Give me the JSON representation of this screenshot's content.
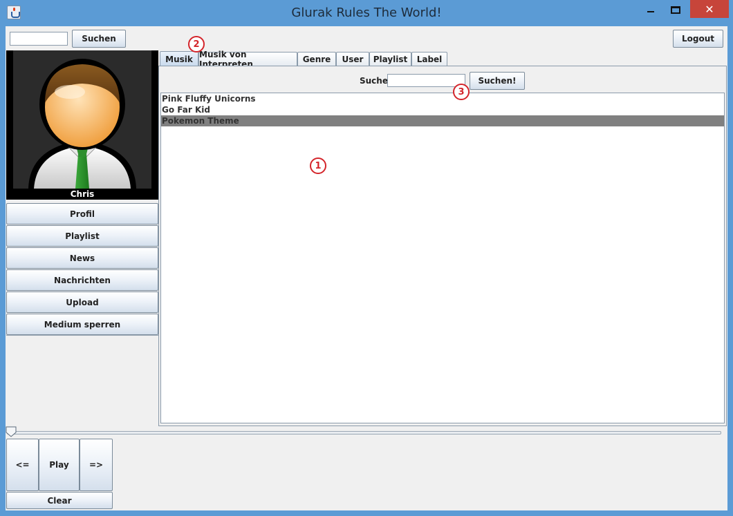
{
  "window": {
    "title": "Glurak Rules The World!",
    "close_symbol": "✕"
  },
  "topbar": {
    "search_value": "",
    "search_button": "Suchen",
    "logout_button": "Logout"
  },
  "user": {
    "name": "Chris"
  },
  "sidebar": {
    "items": [
      {
        "label": "Profil"
      },
      {
        "label": "Playlist"
      },
      {
        "label": "News"
      },
      {
        "label": "Nachrichten"
      },
      {
        "label": "Upload"
      },
      {
        "label": "Medium sperren"
      }
    ]
  },
  "tabs": [
    {
      "label": "Musik",
      "active": true
    },
    {
      "label": "Musik von Interpreten",
      "active": false
    },
    {
      "label": "Genre",
      "active": false
    },
    {
      "label": "User",
      "active": false
    },
    {
      "label": "Playlist",
      "active": false
    },
    {
      "label": "Label",
      "active": false
    }
  ],
  "panel": {
    "search_label": "Suche",
    "search_value": "",
    "search_button": "Suchen!",
    "songs": [
      {
        "title": "Pink Fluffy Unicorns",
        "selected": false
      },
      {
        "title": "Go Far Kid",
        "selected": false
      },
      {
        "title": "Pokemon Theme",
        "selected": true
      }
    ]
  },
  "annotations": [
    "1",
    "2",
    "3"
  ],
  "player": {
    "prev_label": "<=",
    "play_label": "Play",
    "next_label": "=>",
    "clear_label": "Clear",
    "progress": 0
  },
  "colors": {
    "titlebar": "#5b9bd5",
    "selected_row": "#808080",
    "annotation": "#d4242a"
  }
}
